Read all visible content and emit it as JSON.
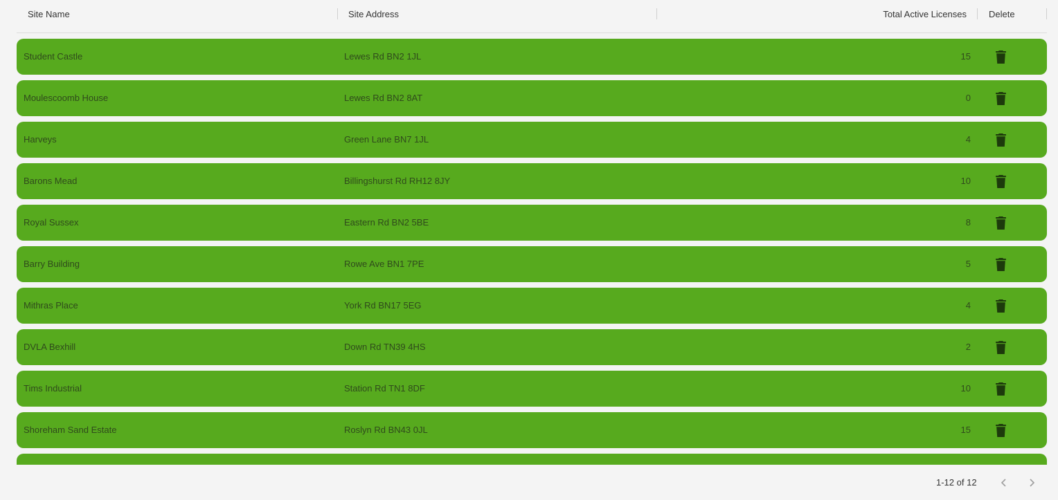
{
  "table": {
    "columns": {
      "site_name": "Site Name",
      "site_address": "Site Address",
      "total_active_licenses": "Total Active Licenses",
      "delete": "Delete"
    },
    "rows": [
      {
        "name": "Student Castle",
        "address": "Lewes Rd BN2 1JL",
        "licenses": "15"
      },
      {
        "name": "Moulescoomb House",
        "address": "Lewes Rd BN2 8AT",
        "licenses": "0"
      },
      {
        "name": "Harveys",
        "address": "Green Lane BN7 1JL",
        "licenses": "4"
      },
      {
        "name": "Barons Mead",
        "address": "Billingshurst Rd RH12 8JY",
        "licenses": "10"
      },
      {
        "name": "Royal Sussex",
        "address": "Eastern Rd BN2 5BE",
        "licenses": "8"
      },
      {
        "name": "Barry Building",
        "address": "Rowe Ave BN1 7PE",
        "licenses": "5"
      },
      {
        "name": "Mithras Place",
        "address": "York Rd BN17 5EG",
        "licenses": "4"
      },
      {
        "name": "DVLA Bexhill",
        "address": "Down Rd TN39 4HS",
        "licenses": "2"
      },
      {
        "name": "Tims Industrial",
        "address": "Station Rd TN1 8DF",
        "licenses": "10"
      },
      {
        "name": "Shoreham Sand Estate",
        "address": "Roslyn Rd BN43 0JL",
        "licenses": "15"
      },
      {
        "name": "",
        "address": "",
        "licenses": ""
      }
    ],
    "row_icon": "trash-icon"
  },
  "pagination": {
    "range_label": "1-12 of 12",
    "prev_icon": "chevron-left-icon",
    "next_icon": "chevron-right-icon"
  },
  "colors": {
    "row_background": "#57aa1e",
    "row_text": "#2f4a1c",
    "icon": "#1d3a0c",
    "page_background": "#f4f4f4"
  }
}
